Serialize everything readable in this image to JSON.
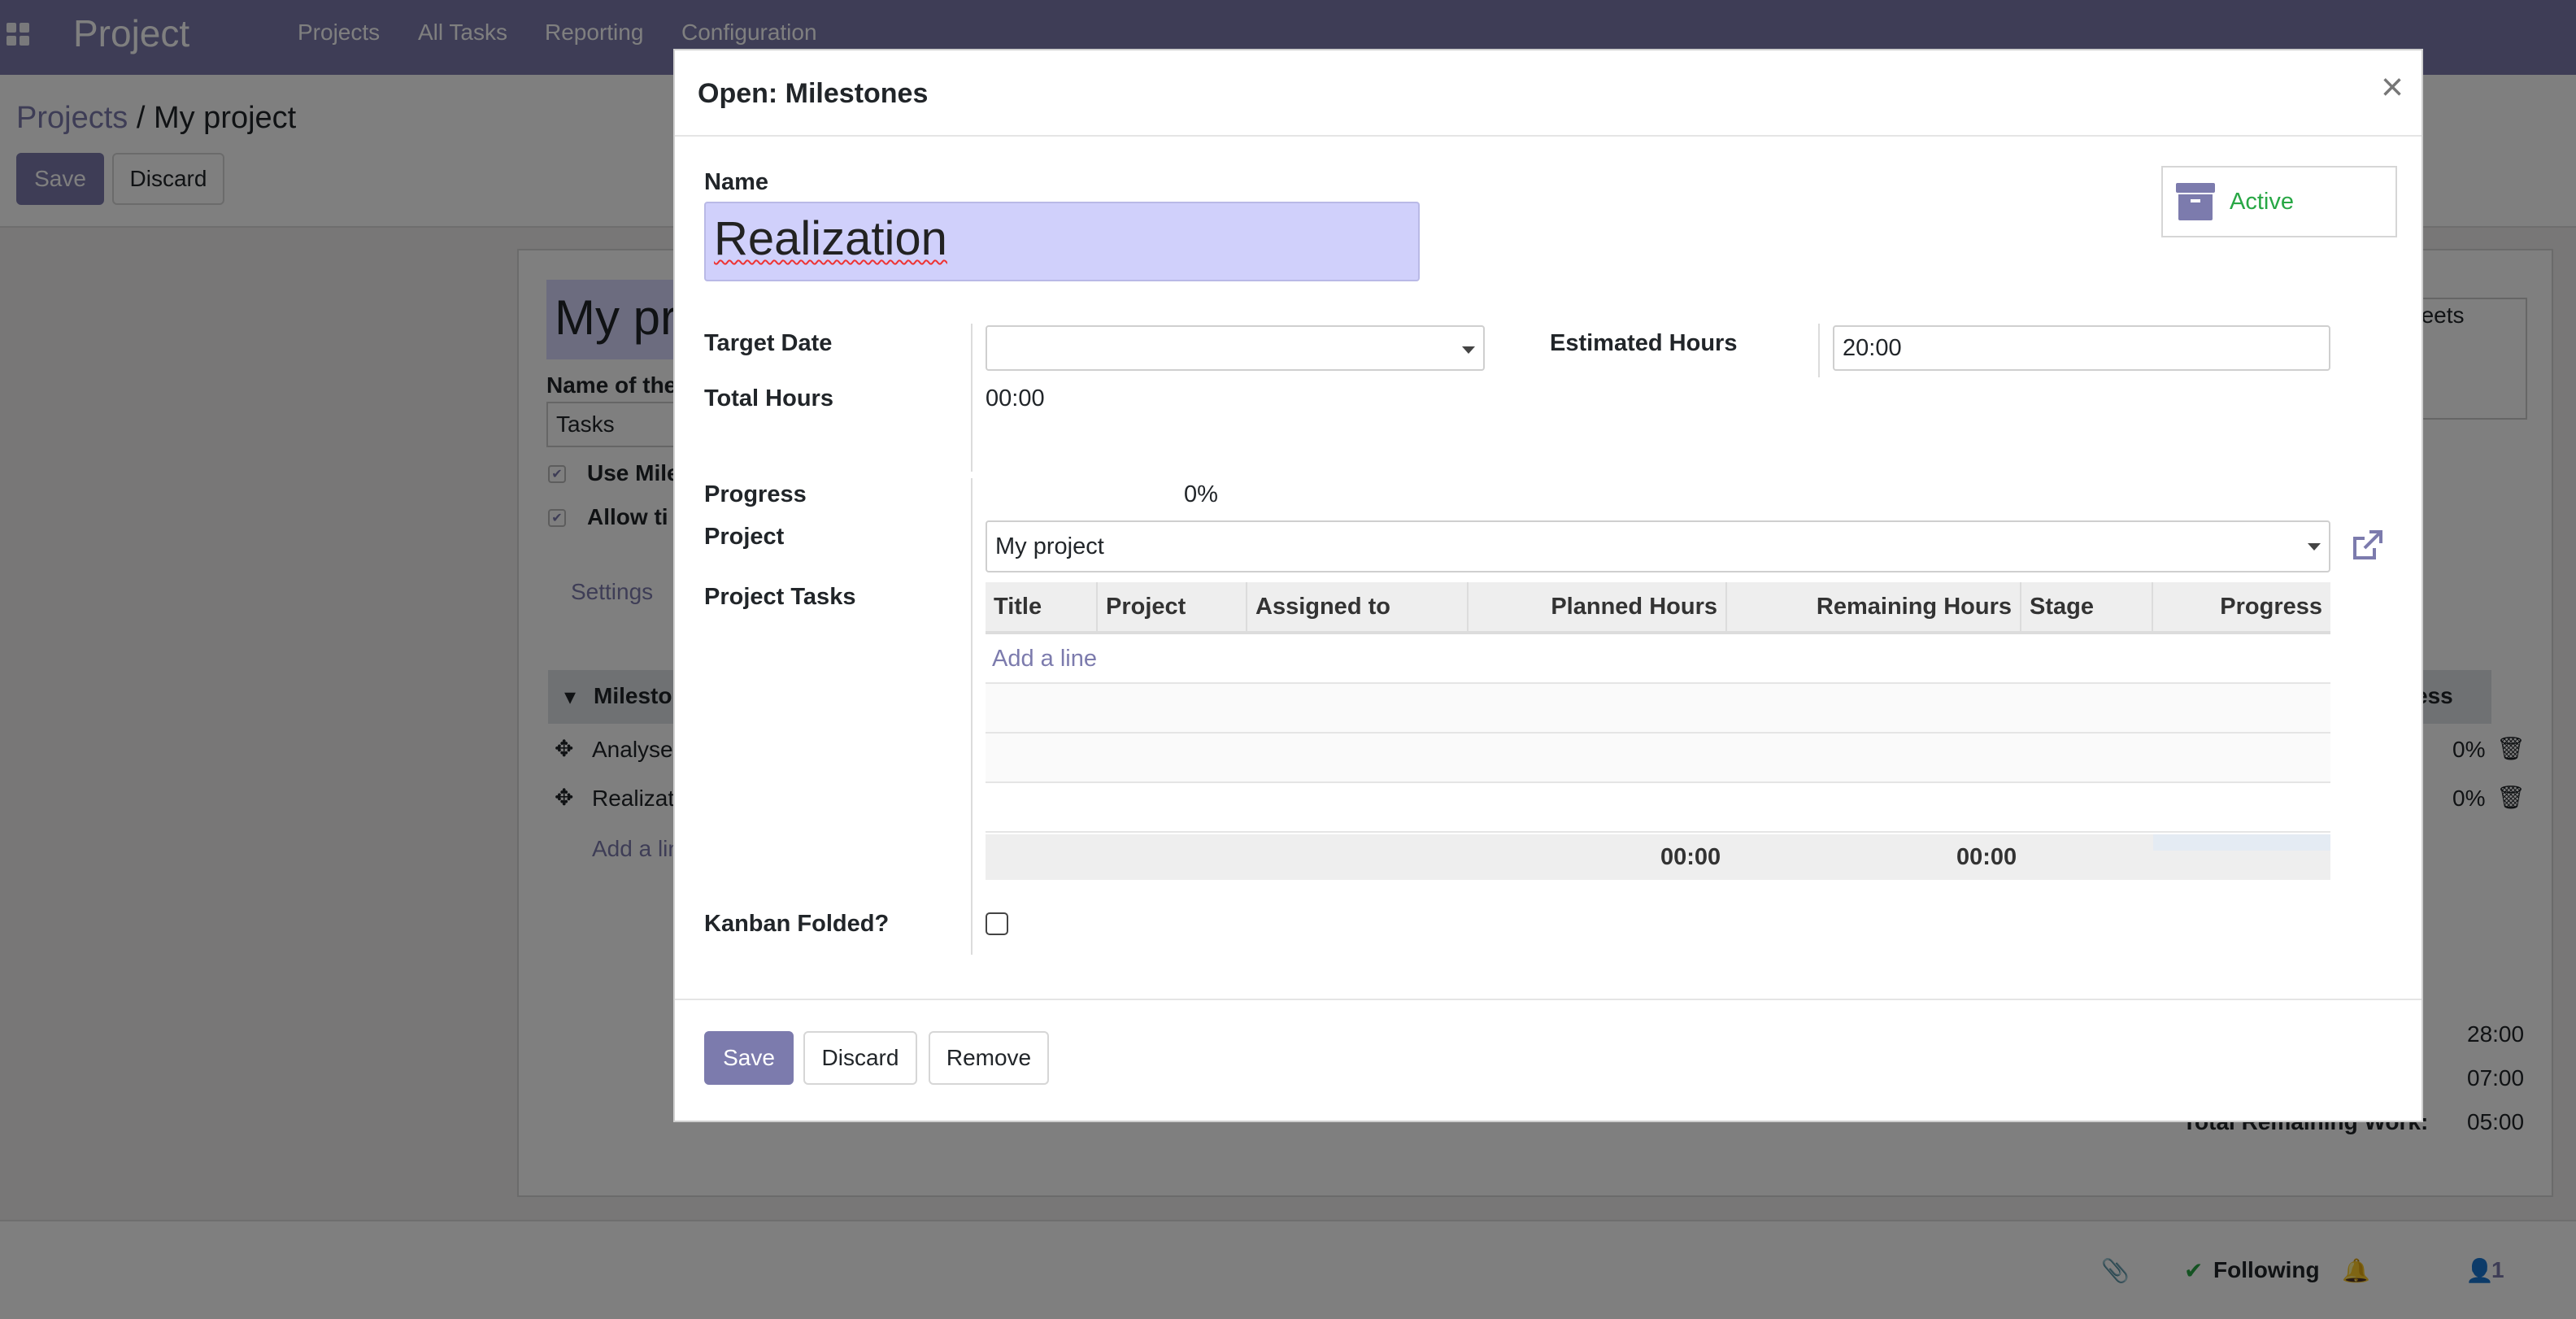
{
  "app": {
    "brand": "Project",
    "menu": [
      "Projects",
      "All Tasks",
      "Reporting",
      "Configuration"
    ]
  },
  "background": {
    "breadcrumb": {
      "parent": "Projects",
      "separator": "/",
      "current": "My project"
    },
    "save_label": "Save",
    "discard_label": "Discard",
    "project_title": "My pr",
    "name_of_label": "Name of the",
    "tasks_value": "Tasks",
    "use_milestones": "Use Mile",
    "allow_timesheets": "Allow ti",
    "settings_tab": "Settings",
    "timesheets_fragment": "heets",
    "milestones_header": "Milesto",
    "progress_header_fragment": "ess",
    "rows": [
      {
        "name": "Analyse",
        "progress": "0%"
      },
      {
        "name": "Realizat",
        "progress": "0%"
      }
    ],
    "add_line": "Add a lin",
    "totals": [
      {
        "label": ":",
        "value": "28:00"
      },
      {
        "label": ":",
        "value": "07:00"
      },
      {
        "label": "Total Remaining Work:",
        "value": "05:00"
      }
    ],
    "following_label": "Following",
    "followers_count": "1"
  },
  "modal": {
    "title": "Open: Milestones",
    "name_label": "Name",
    "name_value": "Realization",
    "active_label": "Active",
    "target_date_label": "Target Date",
    "target_date_value": "",
    "estimated_hours_label": "Estimated Hours",
    "estimated_hours_value": "20:00",
    "total_hours_label": "Total Hours",
    "total_hours_value": "00:00",
    "progress_label": "Progress",
    "progress_value": "0%",
    "project_label": "Project",
    "project_value": "My project",
    "project_tasks_label": "Project Tasks",
    "table": {
      "columns": [
        "Title",
        "Project",
        "Assigned to",
        "Planned Hours",
        "Remaining Hours",
        "Stage",
        "Progress"
      ],
      "add_line": "Add a line",
      "totals": {
        "planned": "00:00",
        "remaining": "00:00"
      }
    },
    "kanban_folded_label": "Kanban Folded?",
    "kanban_folded": false,
    "buttons": {
      "save": "Save",
      "discard": "Discard",
      "remove": "Remove"
    }
  },
  "colors": {
    "brand": "#7c7bad",
    "active": "#28a745"
  }
}
